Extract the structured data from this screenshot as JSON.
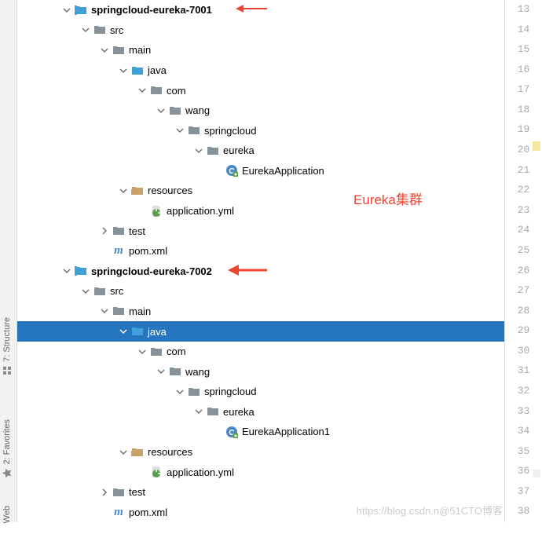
{
  "leftTabs": {
    "structure": "7: Structure",
    "favorites": "2: Favorites",
    "web": "Web"
  },
  "lineNumbers": [
    "13",
    "14",
    "15",
    "16",
    "17",
    "18",
    "19",
    "20",
    "21",
    "22",
    "23",
    "24",
    "25",
    "26",
    "27",
    "28",
    "29",
    "30",
    "31",
    "32",
    "33",
    "34",
    "35",
    "36",
    "37",
    "38"
  ],
  "annotations": {
    "cluster": "Eureka集群"
  },
  "watermark": "https://blog.csdn.n@51CTO博客",
  "tree": [
    {
      "indent": 56,
      "chev": "down",
      "icon": "folder-module",
      "label": "springcloud-eureka-7001",
      "bold": true,
      "arrow": true
    },
    {
      "indent": 80,
      "chev": "down",
      "icon": "folder-closed",
      "label": "src"
    },
    {
      "indent": 104,
      "chev": "down",
      "icon": "folder-closed",
      "label": "main"
    },
    {
      "indent": 128,
      "chev": "down",
      "icon": "folder-blue",
      "label": "java"
    },
    {
      "indent": 152,
      "chev": "down",
      "icon": "folder-pkg",
      "label": "com"
    },
    {
      "indent": 176,
      "chev": "down",
      "icon": "folder-pkg",
      "label": "wang"
    },
    {
      "indent": 200,
      "chev": "down",
      "icon": "folder-pkg",
      "label": "springcloud"
    },
    {
      "indent": 224,
      "chev": "down",
      "icon": "folder-pkg",
      "label": "eureka"
    },
    {
      "indent": 248,
      "chev": "none",
      "icon": "file-class",
      "label": "EurekaApplication"
    },
    {
      "indent": 128,
      "chev": "down",
      "icon": "folder-res",
      "label": "resources"
    },
    {
      "indent": 152,
      "chev": "none",
      "icon": "file-yml",
      "label": "application.yml"
    },
    {
      "indent": 104,
      "chev": "right",
      "icon": "folder-closed",
      "label": "test"
    },
    {
      "indent": 104,
      "chev": "none",
      "icon": "file-pom",
      "label": "pom.xml"
    },
    {
      "indent": 56,
      "chev": "down",
      "icon": "folder-module",
      "label": "springcloud-eureka-7002",
      "bold": true,
      "bigarrow": true
    },
    {
      "indent": 80,
      "chev": "down",
      "icon": "folder-closed",
      "label": "src"
    },
    {
      "indent": 104,
      "chev": "down",
      "icon": "folder-closed",
      "label": "main"
    },
    {
      "indent": 128,
      "chev": "down",
      "icon": "folder-blue",
      "label": "java",
      "selected": true
    },
    {
      "indent": 152,
      "chev": "down",
      "icon": "folder-pkg",
      "label": "com"
    },
    {
      "indent": 176,
      "chev": "down",
      "icon": "folder-pkg",
      "label": "wang"
    },
    {
      "indent": 200,
      "chev": "down",
      "icon": "folder-pkg",
      "label": "springcloud"
    },
    {
      "indent": 224,
      "chev": "down",
      "icon": "folder-pkg",
      "label": "eureka"
    },
    {
      "indent": 248,
      "chev": "none",
      "icon": "file-class",
      "label": "EurekaApplication1"
    },
    {
      "indent": 128,
      "chev": "down",
      "icon": "folder-res",
      "label": "resources"
    },
    {
      "indent": 152,
      "chev": "none",
      "icon": "file-yml",
      "label": "application.yml"
    },
    {
      "indent": 104,
      "chev": "right",
      "icon": "folder-closed",
      "label": "test"
    },
    {
      "indent": 104,
      "chev": "none",
      "icon": "file-pom",
      "label": "pom.xml"
    }
  ]
}
